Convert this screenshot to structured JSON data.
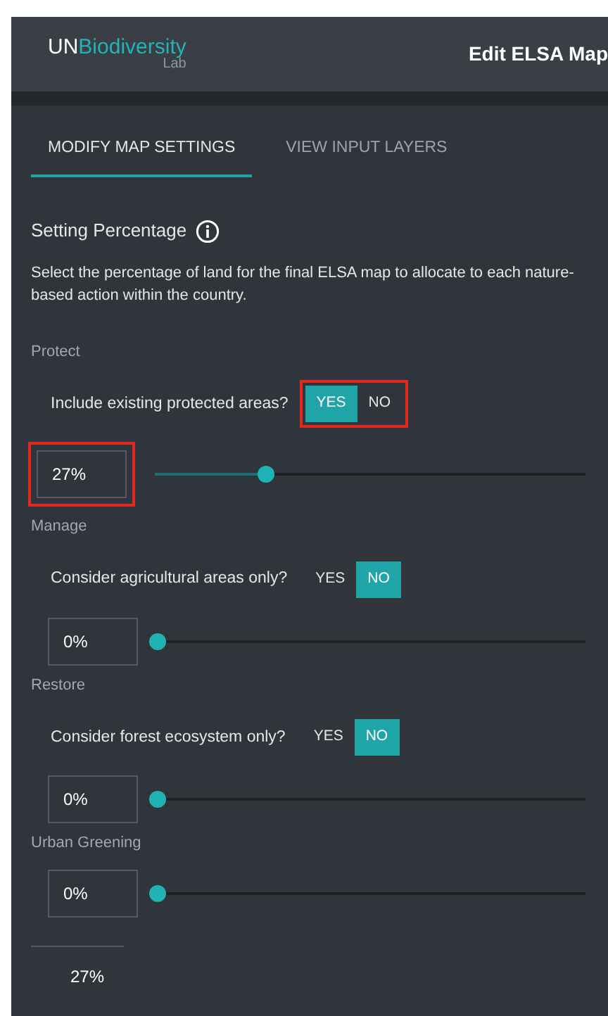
{
  "header": {
    "logo": {
      "strong": "UN",
      "accent": "Biodiversity",
      "sub": "Lab"
    },
    "title": "Edit ELSA Map"
  },
  "tabs": [
    {
      "label": "MODIFY MAP SETTINGS",
      "selected": true
    },
    {
      "label": "VIEW INPUT LAYERS",
      "selected": false
    }
  ],
  "heading": "Setting Percentage",
  "description": "Select the percentage of land for the final ELSA map to allocate to each nature-based action within the country.",
  "actions": [
    {
      "label": "Protect",
      "question": "Include existing protected areas?",
      "options": [
        {
          "label": "YES",
          "selected": true
        },
        {
          "label": "NO",
          "selected": false
        }
      ],
      "toggle_highlighted": true,
      "value": "27%",
      "value_highlighted": true,
      "level": 0.27
    },
    {
      "label": "Manage",
      "question": "Consider agricultural areas only?",
      "options": [
        {
          "label": "YES",
          "selected": false
        },
        {
          "label": "NO",
          "selected": true
        }
      ],
      "toggle_highlighted": false,
      "value": "0%",
      "value_highlighted": false,
      "level": 0
    },
    {
      "label": "Restore",
      "question": "Consider forest ecosystem only?",
      "options": [
        {
          "label": "YES",
          "selected": false
        },
        {
          "label": "NO",
          "selected": true
        }
      ],
      "toggle_highlighted": false,
      "value": "0%",
      "value_highlighted": false,
      "level": 0
    },
    {
      "label": "Urban Greening",
      "value": "0%",
      "value_highlighted": false,
      "level": 0
    }
  ],
  "total": "27%"
}
